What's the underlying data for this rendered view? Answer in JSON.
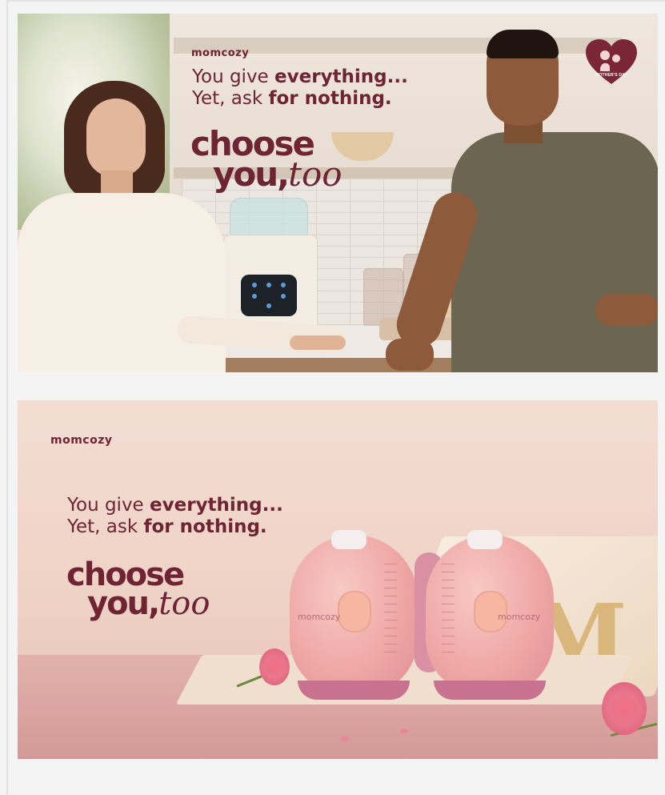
{
  "banner1": {
    "brand": "momcozy",
    "headline_line1_pre": "You give ",
    "headline_line1_bold": "everything...",
    "headline_line2_pre": "Yet, ask ",
    "headline_line2_bold": "for nothing.",
    "choose": "choose",
    "you": "you,",
    "too": "too",
    "badge": "MOTHER'S DAY"
  },
  "banner2": {
    "brand": "momcozy",
    "headline_line1_pre": "You give ",
    "headline_line1_bold": "everything...",
    "headline_line2_pre": "Yet, ask ",
    "headline_line2_bold": "for nothing.",
    "choose": "choose",
    "you": "you,",
    "too": "too",
    "pump_logo_left": "momcozy",
    "pump_logo_right": "momcozy"
  },
  "colors": {
    "brand_wine": "#6f2434",
    "page_bg": "#f4f4f4",
    "pump_pink": "#efa8a6"
  }
}
